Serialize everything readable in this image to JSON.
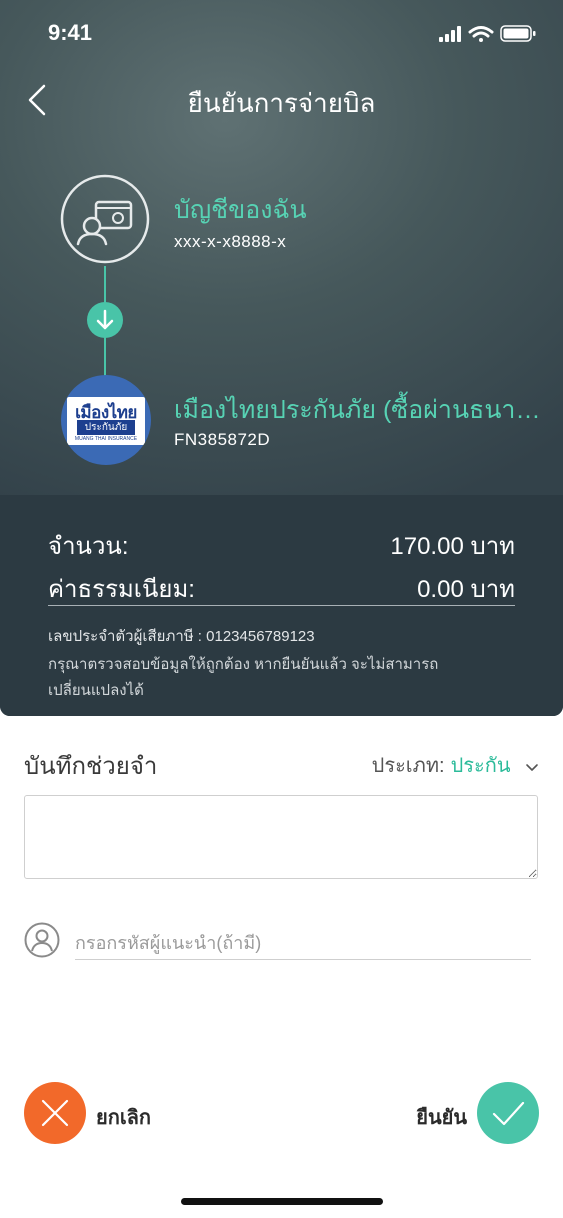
{
  "status_bar": {
    "time": "9:41"
  },
  "header": {
    "title": "ยืนยันการจ่ายบิล",
    "back_icon": "chevron-left-icon"
  },
  "from_account": {
    "name": "บัญชีของฉัน",
    "number": "xxx-x-x8888-x",
    "icon": "account-card-icon"
  },
  "to_biller": {
    "name": "เมืองไทยประกันภัย (ซื้อผ่านธนาคาร)",
    "ref": "FN385872D",
    "logo_line1": "เมืองไทย",
    "logo_line2": "ประกันภัย",
    "logo_line3": "MUANG THAI INSURANCE"
  },
  "summary": {
    "amount_label": "จำนวน:",
    "amount_value": "170.00 บาท",
    "fee_label": "ค่าธรรมเนียม:",
    "fee_value": "0.00 บาท",
    "tax_id": "เลขประจำตัวผู้เสียภาษี : 0123456789123",
    "notice": "กรุณาตรวจสอบข้อมูลให้ถูกต้อง หากยืนยันแล้ว จะไม่สามารถเปลี่ยนแปลงได้"
  },
  "memo": {
    "title": "บันทึกช่วยจำ",
    "type_label": "ประเภท:",
    "type_value": "ประกัน",
    "memo_value": ""
  },
  "referral": {
    "placeholder": "กรอกรหัสผู้แนะนำ(ถ้ามี)"
  },
  "actions": {
    "cancel_label": "ยกเลิก",
    "confirm_label": "ยืนยัน"
  },
  "colors": {
    "accent": "#49c4a8",
    "cancel": "#f2692a",
    "panel": "#33424a"
  }
}
